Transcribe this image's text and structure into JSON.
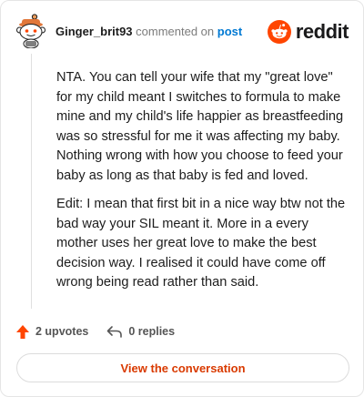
{
  "header": {
    "username": "Ginger_brit93",
    "action": " commented on ",
    "target": "post",
    "brand": "reddit"
  },
  "comment": {
    "paragraphs": [
      "NTA. You can tell your wife that my \"great love\" for my child meant I switches to formula to make mine and my child's life happier as breastfeeding was so stressful for me it was affecting my baby. Nothing wrong with how you choose to feed your baby as long as that baby is fed and loved.",
      "Edit: I mean that first bit in a nice way btw not the bad way your SIL meant it. More in a every mother uses her great love to make the best decision way. I realised it could have come off wrong being read rather than said."
    ]
  },
  "stats": {
    "upvotes": "2 upvotes",
    "replies": "0 replies"
  },
  "cta": {
    "label": "View the conversation"
  },
  "colors": {
    "brand": "#ff4500",
    "link": "#0079d3",
    "cta_text": "#d93a00",
    "upvote": "#ff4500"
  },
  "icons": {
    "avatar": "snoo-avatar",
    "brand": "reddit-logo-icon",
    "upvote": "upvote-arrow-icon",
    "reply": "reply-arrow-icon"
  }
}
